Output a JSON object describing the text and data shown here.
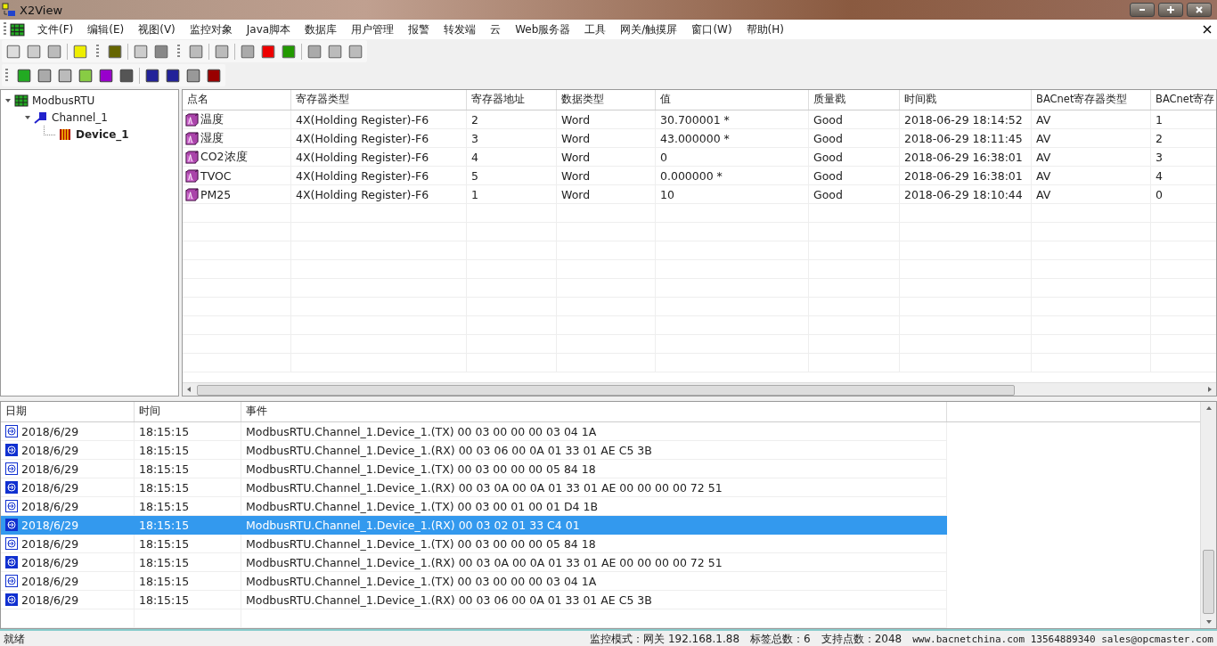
{
  "window": {
    "title": "X2View"
  },
  "menu": [
    "文件(F)",
    "编辑(E)",
    "视图(V)",
    "监控对象",
    "Java脚本",
    "数据库",
    "用户管理",
    "报警",
    "转发端",
    "云",
    "Web服务器",
    "工具",
    "网关/触摸屏",
    "窗口(W)",
    "帮助(H)"
  ],
  "tree": [
    {
      "label": "ModbusRTU",
      "kind": "driver",
      "expanded": true,
      "selected": false,
      "children": [
        {
          "label": "Channel_1",
          "kind": "channel",
          "expanded": true,
          "selected": false,
          "children": [
            {
              "label": "Device_1",
              "kind": "device",
              "selected": true
            }
          ]
        }
      ]
    }
  ],
  "table": {
    "columns": [
      "点名",
      "寄存器类型",
      "寄存器地址",
      "数据类型",
      "值",
      "质量戳",
      "时间戳",
      "BACnet寄存器类型",
      "BACnet寄存"
    ],
    "rows": [
      [
        "温度",
        "4X(Holding Register)-F6",
        "2",
        "Word",
        "30.700001 *",
        "Good",
        "2018-06-29 18:14:52",
        "AV",
        "1"
      ],
      [
        "湿度",
        "4X(Holding Register)-F6",
        "3",
        "Word",
        "43.000000 *",
        "Good",
        "2018-06-29 18:11:45",
        "AV",
        "2"
      ],
      [
        "CO2浓度",
        "4X(Holding Register)-F6",
        "4",
        "Word",
        "0",
        "Good",
        "2018-06-29 16:38:01",
        "AV",
        "3"
      ],
      [
        "TVOC",
        "4X(Holding Register)-F6",
        "5",
        "Word",
        "0.000000 *",
        "Good",
        "2018-06-29 16:38:01",
        "AV",
        "4"
      ],
      [
        "PM25",
        "4X(Holding Register)-F6",
        "1",
        "Word",
        "10",
        "Good",
        "2018-06-29 18:10:44",
        "AV",
        "0"
      ]
    ]
  },
  "log": {
    "columns": [
      "日期",
      "时间",
      "事件"
    ],
    "rows": [
      {
        "kind": "tx",
        "selected": false,
        "date": "2018/6/29",
        "time": "18:15:15",
        "event": "ModbusRTU.Channel_1.Device_1.(TX) 00 03 00 00 00 03 04 1A"
      },
      {
        "kind": "rx",
        "selected": false,
        "date": "2018/6/29",
        "time": "18:15:15",
        "event": "ModbusRTU.Channel_1.Device_1.(RX) 00 03 06 00 0A 01 33 01 AE C5 3B"
      },
      {
        "kind": "tx",
        "selected": false,
        "date": "2018/6/29",
        "time": "18:15:15",
        "event": "ModbusRTU.Channel_1.Device_1.(TX) 00 03 00 00 00 05 84 18"
      },
      {
        "kind": "rx",
        "selected": false,
        "date": "2018/6/29",
        "time": "18:15:15",
        "event": "ModbusRTU.Channel_1.Device_1.(RX) 00 03 0A 00 0A 01 33 01 AE 00 00 00 00 72 51"
      },
      {
        "kind": "tx",
        "selected": false,
        "date": "2018/6/29",
        "time": "18:15:15",
        "event": "ModbusRTU.Channel_1.Device_1.(TX) 00 03 00 01 00 01 D4 1B"
      },
      {
        "kind": "rx",
        "selected": true,
        "date": "2018/6/29",
        "time": "18:15:15",
        "event": "ModbusRTU.Channel_1.Device_1.(RX) 00 03 02 01 33 C4 01"
      },
      {
        "kind": "tx",
        "selected": false,
        "date": "2018/6/29",
        "time": "18:15:15",
        "event": "ModbusRTU.Channel_1.Device_1.(TX) 00 03 00 00 00 05 84 18"
      },
      {
        "kind": "rx",
        "selected": false,
        "date": "2018/6/29",
        "time": "18:15:15",
        "event": "ModbusRTU.Channel_1.Device_1.(RX) 00 03 0A 00 0A 01 33 01 AE 00 00 00 00 72 51"
      },
      {
        "kind": "tx",
        "selected": false,
        "date": "2018/6/29",
        "time": "18:15:15",
        "event": "ModbusRTU.Channel_1.Device_1.(TX) 00 03 00 00 00 03 04 1A"
      },
      {
        "kind": "rx",
        "selected": false,
        "date": "2018/6/29",
        "time": "18:15:15",
        "event": "ModbusRTU.Channel_1.Device_1.(RX) 00 03 06 00 0A 01 33 01 AE C5 3B"
      }
    ]
  },
  "status_bar": {
    "state": "就绪",
    "mode": "监控模式：网关 192.168.1.88",
    "tag_count": "标签总数：6",
    "supported_points": "支持点数：2048",
    "contact": "www.bacnetchina.com 13564889340 sales@opcmaster.com"
  }
}
